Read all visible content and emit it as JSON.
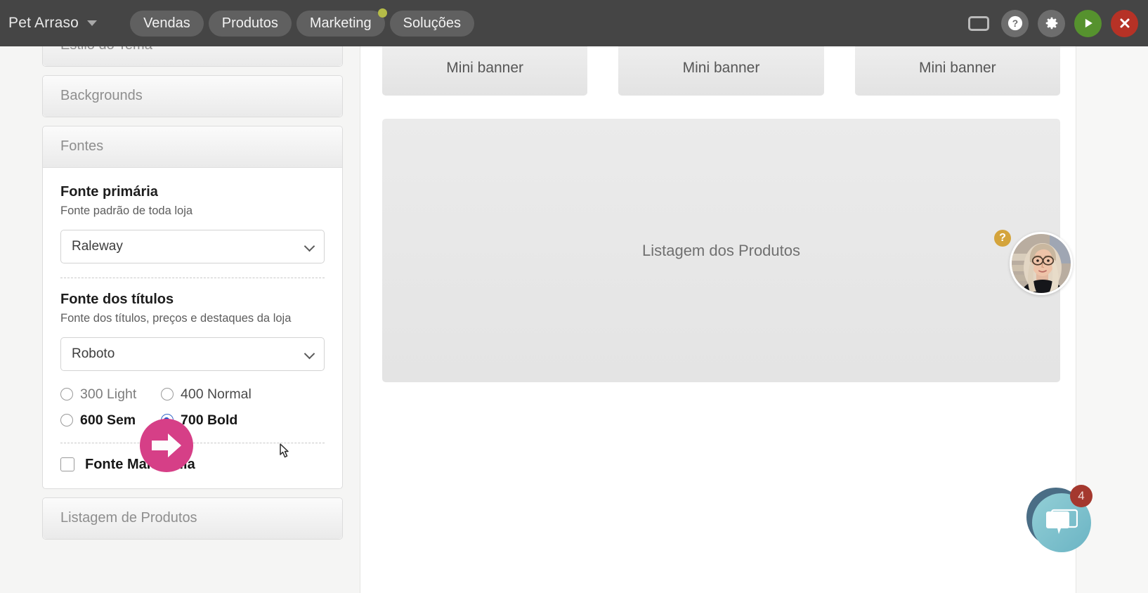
{
  "topbar": {
    "brand": "Pet Arraso",
    "brand_caret_icon": "chevron-down-icon",
    "tabs": [
      {
        "label": "Vendas",
        "has_dot": false
      },
      {
        "label": "Produtos",
        "has_dot": false
      },
      {
        "label": "Marketing",
        "has_dot": true
      },
      {
        "label": "Soluções",
        "has_dot": false
      }
    ],
    "actions": [
      {
        "name": "screen-icon",
        "glyph": "",
        "style": "plain"
      },
      {
        "name": "help-icon",
        "glyph": "?",
        "style": "grey"
      },
      {
        "name": "gear-icon",
        "glyph": "✿",
        "style": "grey"
      },
      {
        "name": "play-icon",
        "glyph": "▶",
        "style": "green"
      },
      {
        "name": "close-icon",
        "glyph": "✕",
        "style": "red"
      }
    ],
    "colors": {
      "bar_bg": "#454545",
      "tab_bg": "#606060",
      "dot": "#b5bc48",
      "play": "#56922e",
      "close": "#b63226"
    }
  },
  "sidebar": {
    "panels": [
      {
        "title": "Estilo do Tema",
        "open": false
      },
      {
        "title": "Backgrounds",
        "open": false
      },
      {
        "title": "Fontes",
        "open": true
      },
      {
        "title": "Listagem de Produtos",
        "open": false
      }
    ],
    "fontes": {
      "primary": {
        "title": "Fonte primária",
        "description": "Fonte padrão de toda loja",
        "selected": "Raleway",
        "chevron_icon": "chevron-down-icon"
      },
      "titles": {
        "title": "Fonte dos títulos",
        "description": "Fonte dos títulos, preços e destaques da loja",
        "selected": "Roboto",
        "chevron_icon": "chevron-down-icon",
        "weights": [
          {
            "label": "300 Light",
            "checked": false,
            "style": "light"
          },
          {
            "label": "400 Normal",
            "checked": false,
            "style": "normal"
          },
          {
            "label": "600 Sem",
            "checked": false,
            "style": "bold"
          },
          {
            "label": "700 Bold",
            "checked": true,
            "style": "bold"
          }
        ]
      },
      "uppercase": {
        "label": "Fonte Maiuscula",
        "checked": false
      }
    }
  },
  "preview": {
    "mini_banners": [
      "Mini banner",
      "Mini banner",
      "Mini banner"
    ],
    "product_listing": "Listagem dos Produtos"
  },
  "overlays": {
    "help_badge": {
      "label": "?",
      "color": "#d4a43c"
    },
    "agent_avatar": {
      "name": "support-agent-avatar"
    },
    "chat": {
      "badge_count": "4",
      "icon": "chat-bubble-icon",
      "circle_color": "#6bb4c4",
      "badge_color": "#a4382e"
    },
    "annotation_arrow": {
      "color": "#d63f87",
      "icon": "arrow-right-icon"
    },
    "cursor": {
      "icon": "pointer-cursor"
    }
  }
}
